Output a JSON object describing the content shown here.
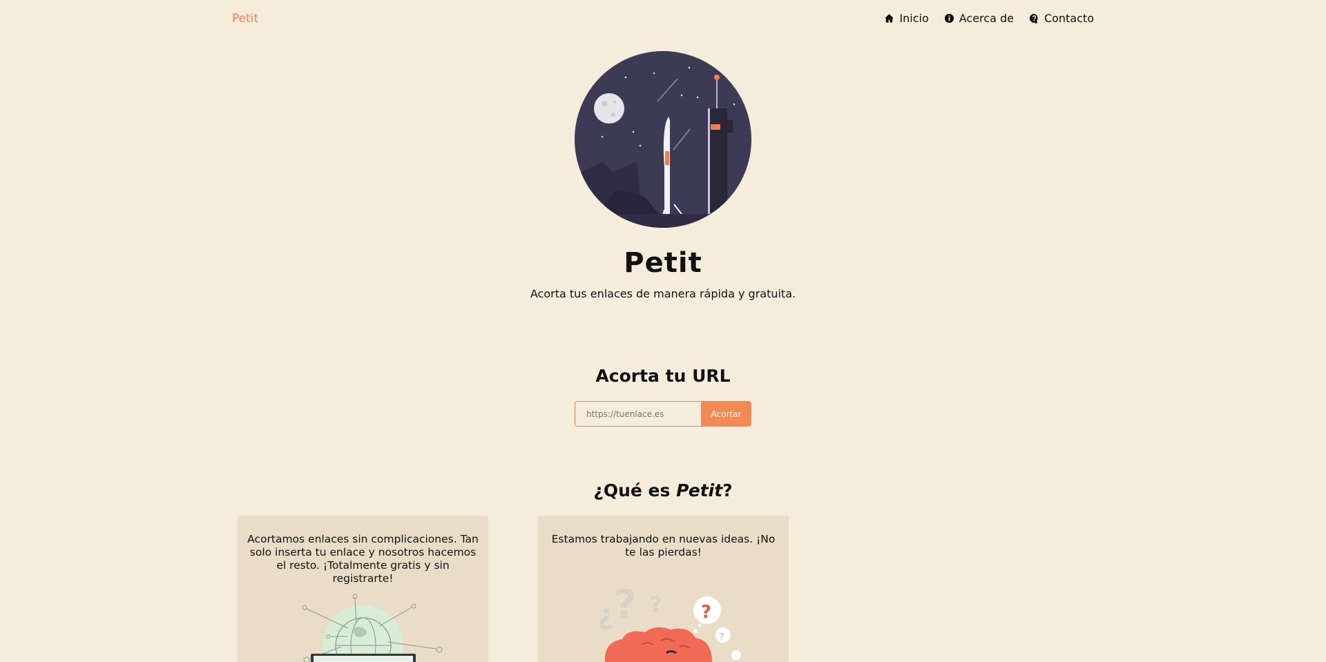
{
  "nav": {
    "brand": "Petit",
    "links": [
      {
        "label": "Inicio",
        "icon": "home-icon"
      },
      {
        "label": "Acerca de",
        "icon": "info-icon"
      },
      {
        "label": "Contacto",
        "icon": "help-icon"
      }
    ]
  },
  "hero": {
    "title": "Petit",
    "subtitle": "Acorta tus enlaces de manera rápida y gratuita."
  },
  "shorten": {
    "title": "Acorta tu URL",
    "placeholder": "https://tuenlace.es",
    "button": "Acortar"
  },
  "about": {
    "title_prefix": "¿Qué es ",
    "title_brand": "Petit",
    "title_suffix": "?",
    "cards": [
      {
        "text": "Acortamos enlaces sin complicaciones. Tan solo inserta tu enlace y nosotros hacemos el resto. ¡Totalmente gratis y sin registrarte!"
      },
      {
        "text": "Estamos trabajando en nuevas ideas. ¡No te las pierdas!"
      }
    ]
  },
  "colors": {
    "background": "#f5ecdb",
    "accent": "#f07f4d",
    "card": "#eaddc8",
    "night": "#3d3a55"
  }
}
